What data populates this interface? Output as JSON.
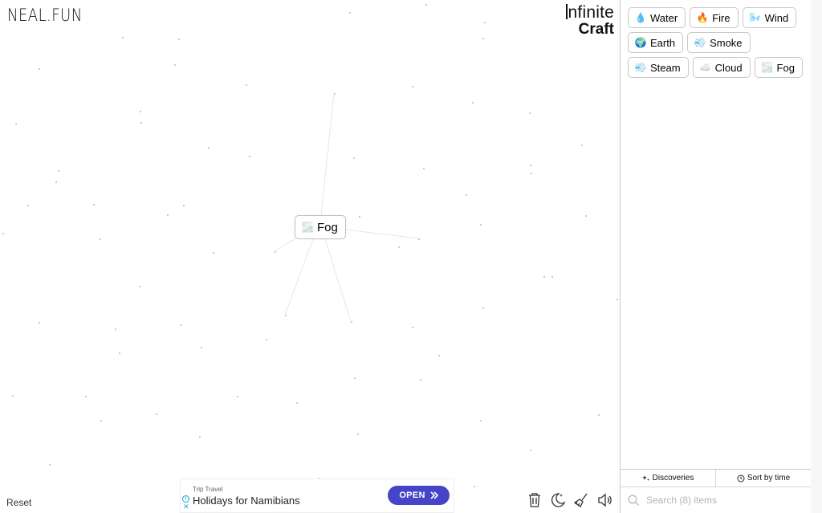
{
  "header": {
    "site_logo": "NEAL.FUN",
    "game_logo_line1": "nfinite",
    "game_logo_line2": "Craft"
  },
  "canvas": {
    "placed_item": {
      "emoji": "🌫️",
      "icon": "fog-icon",
      "label": "Fog"
    },
    "reset_label": "Reset"
  },
  "sidebar": {
    "items": [
      {
        "icon": "water-drop-icon",
        "emoji": "💧",
        "label": "Water"
      },
      {
        "icon": "fire-icon",
        "emoji": "🔥",
        "label": "Fire"
      },
      {
        "icon": "wind-icon",
        "emoji": "🌬️",
        "label": "Wind"
      },
      {
        "icon": "earth-icon",
        "emoji": "🌍",
        "label": "Earth"
      },
      {
        "icon": "smoke-icon",
        "emoji": "💨",
        "label": "Smoke"
      },
      {
        "icon": "steam-icon",
        "emoji": "💨",
        "label": "Steam"
      },
      {
        "icon": "cloud-icon",
        "emoji": "☁️",
        "label": "Cloud"
      },
      {
        "icon": "fog-icon",
        "emoji": "🌫️",
        "label": "Fog"
      }
    ],
    "discoveries_label": "Discoveries",
    "sort_label": "Sort by time",
    "search_placeholder": "Search (8) items"
  },
  "ad": {
    "source": "Trip Travel",
    "title": "Holidays for Namibians",
    "cta": "OPEN"
  },
  "tools": [
    {
      "name": "trash-icon"
    },
    {
      "name": "dark-mode-icon"
    },
    {
      "name": "broom-icon"
    },
    {
      "name": "sound-icon"
    }
  ]
}
